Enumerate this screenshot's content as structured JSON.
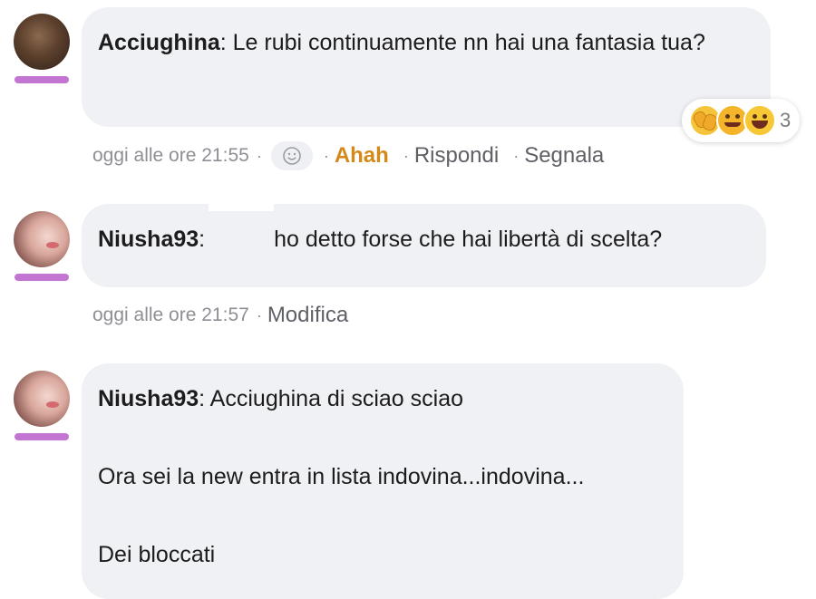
{
  "comments": [
    {
      "author": "Acciughina",
      "text": ": Le rubi continuamente nn hai una fantasia tua?",
      "time": "oggi alle ore 21:55",
      "actions": {
        "reaction": "Ahah",
        "reply": "Rispondi",
        "report": "Segnala"
      },
      "reactions": {
        "icons": [
          "clapping-hands-emoji",
          "hugging-face-emoji",
          "tears-of-joy-emoji"
        ],
        "count": "3"
      }
    },
    {
      "author": "Niusha93",
      "text": "ho detto forse che hai libertà di scelta?",
      "time": "oggi alle ore 21:57",
      "actions": {
        "edit": "Modifica"
      }
    },
    {
      "author": "Niusha93",
      "text": ": Acciughina di sciao sciao",
      "lines": [
        "Ora sei la new entra in lista indovina...indovina...",
        "Dei bloccati"
      ]
    }
  ],
  "colors": {
    "bubble": "#f0f1f4",
    "badge": "#c276d2",
    "accent_ahah": "#d48a19",
    "meta": "#8e8f94"
  }
}
